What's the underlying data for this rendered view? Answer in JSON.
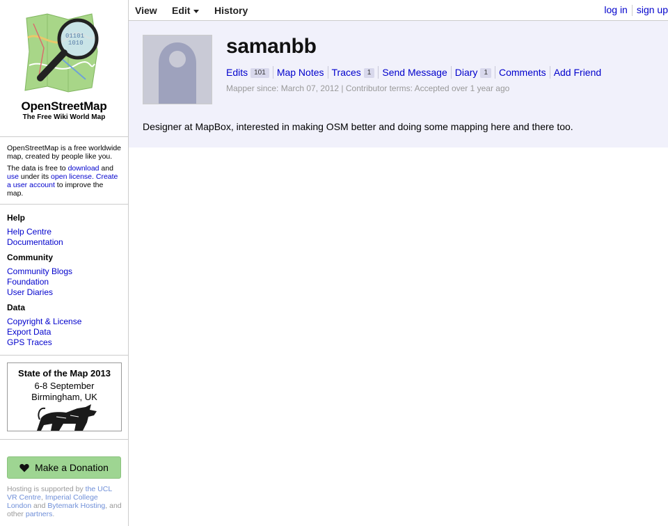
{
  "brand": {
    "name": "OpenStreetMap",
    "tagline": "The Free Wiki World Map"
  },
  "intro": {
    "p1": "OpenStreetMap is a free worldwide map, created by people like you.",
    "p2_a": "The data is free to ",
    "p2_download": "download",
    "p2_b": " and ",
    "p2_use": "use",
    "p2_c": " under its ",
    "p2_license": "open license.",
    "p2_create": "Create a user account",
    "p2_d": " to improve the map."
  },
  "nav": {
    "help": {
      "heading": "Help",
      "items": [
        "Help Centre",
        "Documentation"
      ]
    },
    "community": {
      "heading": "Community",
      "items": [
        "Community Blogs",
        "Foundation",
        "User Diaries"
      ]
    },
    "data": {
      "heading": "Data",
      "items": [
        "Copyright & License",
        "Export Data",
        "GPS Traces"
      ]
    }
  },
  "sotm": {
    "title": "State of the Map 2013",
    "dates": "6-8 September",
    "place": "Birmingham, UK"
  },
  "donate": {
    "label": "Make a Donation",
    "icon": "heart-icon"
  },
  "hosting": {
    "a": "Hosting is supported by ",
    "ucl": "the UCL VR Centre",
    "b": ", ",
    "imperial": "Imperial College London",
    "c": " and ",
    "bytemark": "Bytemark Hosting",
    "d": ", and other ",
    "partners": "partners",
    "e": "."
  },
  "topbar": {
    "tabs": {
      "view": "View",
      "edit": "Edit",
      "history": "History"
    },
    "login": "log in",
    "signup": "sign up"
  },
  "profile": {
    "username": "samanbb",
    "links": {
      "edits": "Edits",
      "edits_count": "101",
      "map_notes": "Map Notes",
      "traces": "Traces",
      "traces_count": "1",
      "send_message": "Send Message",
      "diary": "Diary",
      "diary_count": "1",
      "comments": "Comments",
      "add_friend": "Add Friend"
    },
    "meta": "Mapper since: March 07, 2012 | Contributor terms: Accepted over 1 year ago",
    "bio": "Designer at MapBox, interested in making OSM better and doing some mapping here and there too."
  },
  "colors": {
    "content_bg": "#f1f1fb",
    "link": "#0000cc",
    "donate_bg": "#9ed592",
    "map_green": "#9fd27a",
    "magnifier_ring": "#222222"
  }
}
